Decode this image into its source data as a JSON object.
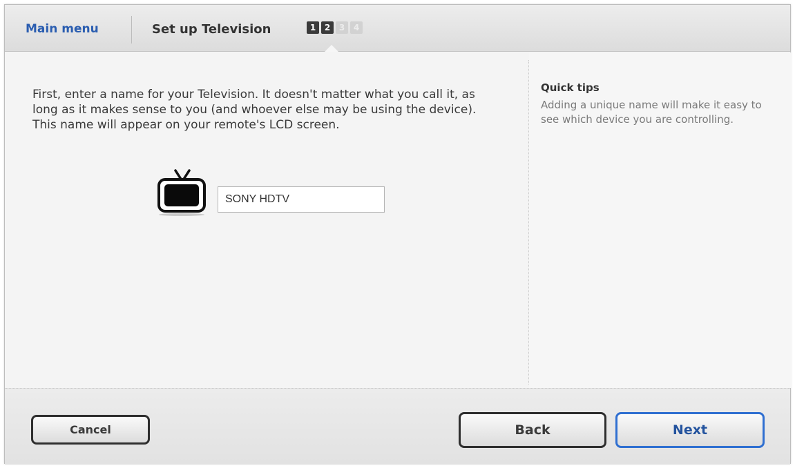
{
  "header": {
    "main_menu_label": "Main menu",
    "title": "Set up Television",
    "steps": [
      {
        "label": "1",
        "state": "active"
      },
      {
        "label": "2",
        "state": "active"
      },
      {
        "label": "3",
        "state": "inactive"
      },
      {
        "label": "4",
        "state": "inactive"
      }
    ]
  },
  "main": {
    "instructions": "First, enter a name for your Television. It doesn't matter what you call it, as long as it makes sense to you (and whoever else may be using the device). This name will appear on your remote's LCD screen.",
    "device_icon": "television-icon",
    "name_input_value": "SONY HDTV"
  },
  "tips": {
    "title": "Quick tips",
    "body": "Adding a unique name will make it easy to see which device you are controlling."
  },
  "footer": {
    "cancel_label": "Cancel",
    "back_label": "Back",
    "next_label": "Next"
  },
  "colors": {
    "link_blue": "#2a5db0",
    "next_border": "#2f6fd1",
    "button_border": "#2e2e2e"
  }
}
